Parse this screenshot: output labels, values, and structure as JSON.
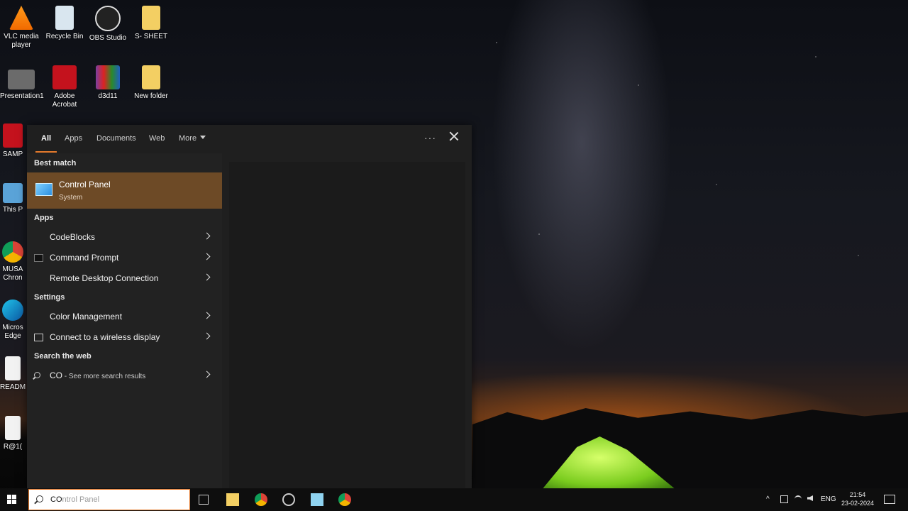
{
  "desktop": {
    "icons": [
      {
        "label": "VLC media player",
        "icon": "vlc-icon"
      },
      {
        "label": "Recycle Bin",
        "icon": "recycle-bin-icon"
      },
      {
        "label": "OBS Studio",
        "icon": "obs-icon"
      },
      {
        "label": "S- SHEET",
        "icon": "folder-icon"
      },
      {
        "label": "Presentation1",
        "icon": "presentation-icon"
      },
      {
        "label": "Adobe Acrobat",
        "icon": "acrobat-icon"
      },
      {
        "label": "d3d11",
        "icon": "winrar-icon"
      },
      {
        "label": "New folder",
        "icon": "folder-icon"
      },
      {
        "label": "SAMP",
        "icon": "pdf-icon"
      },
      {
        "label": "This P",
        "icon": "this-pc-icon"
      },
      {
        "label": "MUSA Chron",
        "icon": "chrome-icon"
      },
      {
        "label": "Micros Edge",
        "icon": "edge-icon"
      },
      {
        "label": "READM",
        "icon": "document-icon"
      },
      {
        "label": "R@1(",
        "icon": "document-icon"
      }
    ]
  },
  "search_panel": {
    "tabs": [
      "All",
      "Apps",
      "Documents",
      "Web",
      "More"
    ],
    "best_match_header": "Best match",
    "best_match": {
      "title": "Control Panel",
      "subtitle": "System"
    },
    "apps_header": "Apps",
    "apps": [
      "CodeBlocks",
      "Command Prompt",
      "Remote Desktop Connection"
    ],
    "settings_header": "Settings",
    "settings": [
      "Color Management",
      "Connect to a wireless display"
    ],
    "web_header": "Search the web",
    "web_query": "CO",
    "web_suffix": " - See more search results",
    "more_options": "···"
  },
  "taskbar": {
    "search_typed": "CO",
    "search_ghost": "ntrol Panel",
    "tray_language": "ENG",
    "time": "21:54",
    "date": "23-02-2024"
  },
  "colors": {
    "accent": "#e57a2c",
    "best_match_bg": "#6d4a26",
    "panel_bg": "#1f1f1f"
  }
}
